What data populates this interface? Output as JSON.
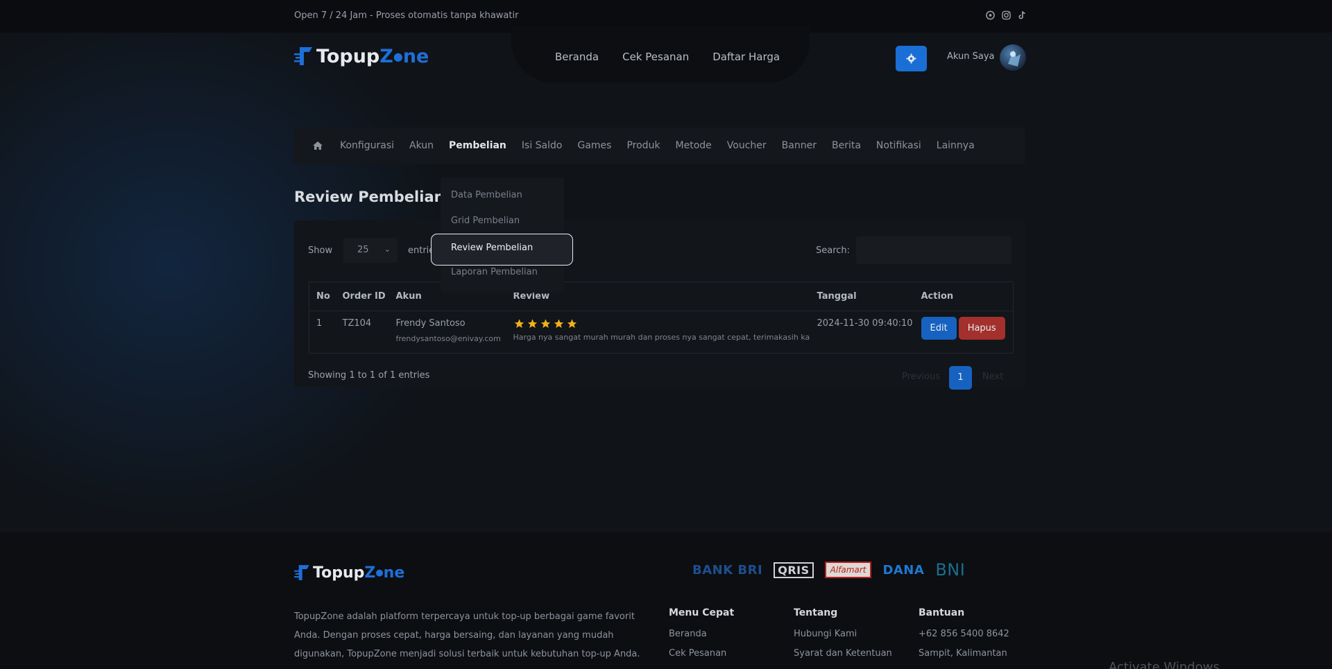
{
  "topbar": {
    "tagline": "Open 7 / 24 Jam - Proses otomatis tanpa khawatir"
  },
  "brand": {
    "part1": "Topup",
    "part2": "Z",
    "part3": "ne"
  },
  "nav": {
    "home": "Beranda",
    "check": "Cek Pesanan",
    "prices": "Daftar Harga"
  },
  "account": {
    "label": "Akun Saya"
  },
  "adminmenu": [
    "Konfigurasi",
    "Akun",
    "Pembelian",
    "Isi Saldo",
    "Games",
    "Produk",
    "Metode",
    "Voucher",
    "Banner",
    "Berita",
    "Notifikasi",
    "Lainnya"
  ],
  "dropdown": {
    "data": "Data Pembelian",
    "grid": "Grid Pembelian",
    "review": "Review Pembelian",
    "report": "Laporan Pembelian"
  },
  "page": {
    "title": "Review Pembelian"
  },
  "table_controls": {
    "show": "Show",
    "entries_value": "25",
    "entries": "entries",
    "search": "Search:"
  },
  "table": {
    "headers": {
      "no": "No",
      "order": "Order ID",
      "akun": "Akun",
      "review": "Review",
      "tanggal": "Tanggal",
      "action": "Action"
    },
    "rows": [
      {
        "no": "1",
        "order": "TZ104",
        "name": "Frendy Santoso",
        "email": "frendysantoso@enivay.com",
        "rating": 5,
        "review": "Harga nya sangat murah murah dan proses nya sangat cepat, terimakasih ka",
        "tanggal": "2024-11-30 09:40:10",
        "edit": "Edit",
        "hapus": "Hapus"
      }
    ]
  },
  "footer_table": {
    "info": "Showing 1 to 1 of 1 entries",
    "previous": "Previous",
    "page": "1",
    "next": "Next"
  },
  "footer": {
    "description": "TopupZone adalah platform terpercaya untuk top-up berbagai game favorit Anda. Dengan proses cepat, harga bersaing, dan layanan yang mudah digunakan, TopupZone menjadi solusi terbaik untuk kebutuhan top-up Anda.",
    "payments": {
      "bri": "BANK BRI",
      "qris": "QRIS",
      "alfamart": "Alfamart",
      "dana": "DANA",
      "bni": "BNI"
    },
    "menu": {
      "title": "Menu Cepat",
      "l1": "Beranda",
      "l2": "Cek Pesanan"
    },
    "about": {
      "title": "Tentang",
      "l1": "Hubungi Kami",
      "l2": "Syarat dan Ketentuan"
    },
    "help": {
      "title": "Bantuan",
      "l1": "+62 856 5400 8642",
      "l2": "Sampit, Kalimantan"
    }
  },
  "watermark": "Activate Windows",
  "colors": {
    "accent": "#1762c0",
    "danger": "#a3302c",
    "star": "#f2b11b"
  }
}
